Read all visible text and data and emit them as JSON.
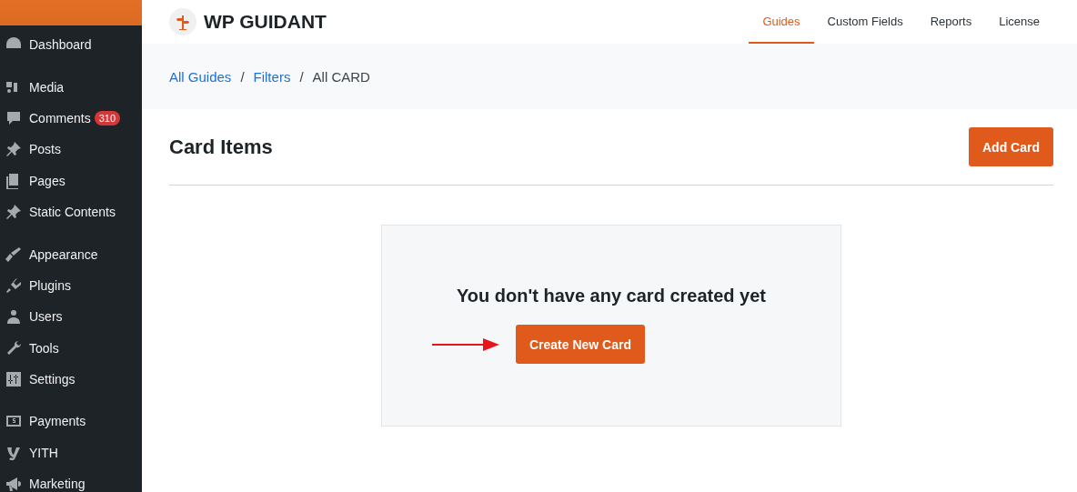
{
  "sidebar": {
    "groups": [
      {
        "items": [
          {
            "label": "Dashboard"
          }
        ]
      },
      {
        "items": [
          {
            "label": "Media"
          },
          {
            "label": "Comments",
            "badge": "310"
          },
          {
            "label": "Posts"
          },
          {
            "label": "Pages"
          },
          {
            "label": "Static Contents"
          }
        ]
      },
      {
        "items": [
          {
            "label": "Appearance"
          },
          {
            "label": "Plugins"
          },
          {
            "label": "Users"
          },
          {
            "label": "Tools"
          },
          {
            "label": "Settings"
          }
        ]
      },
      {
        "items": [
          {
            "label": "Payments"
          },
          {
            "label": "YITH"
          },
          {
            "label": "Marketing"
          }
        ]
      }
    ]
  },
  "header": {
    "logo": "WP GUIDANT",
    "tabs": [
      {
        "label": "Guides",
        "selected": true
      },
      {
        "label": "Custom Fields",
        "selected": false
      },
      {
        "label": "Reports",
        "selected": false
      },
      {
        "label": "License",
        "selected": false
      }
    ]
  },
  "breadcrumb": [
    {
      "label": "All Guides",
      "link": true
    },
    {
      "label": "Filters",
      "link": true
    },
    {
      "label": "All CARD",
      "link": false
    }
  ],
  "separator": "/",
  "page": {
    "title": "Card Items",
    "button": "Add Card"
  },
  "empty_state": {
    "message": "You don't have any card created yet",
    "button": "Create New Card"
  }
}
